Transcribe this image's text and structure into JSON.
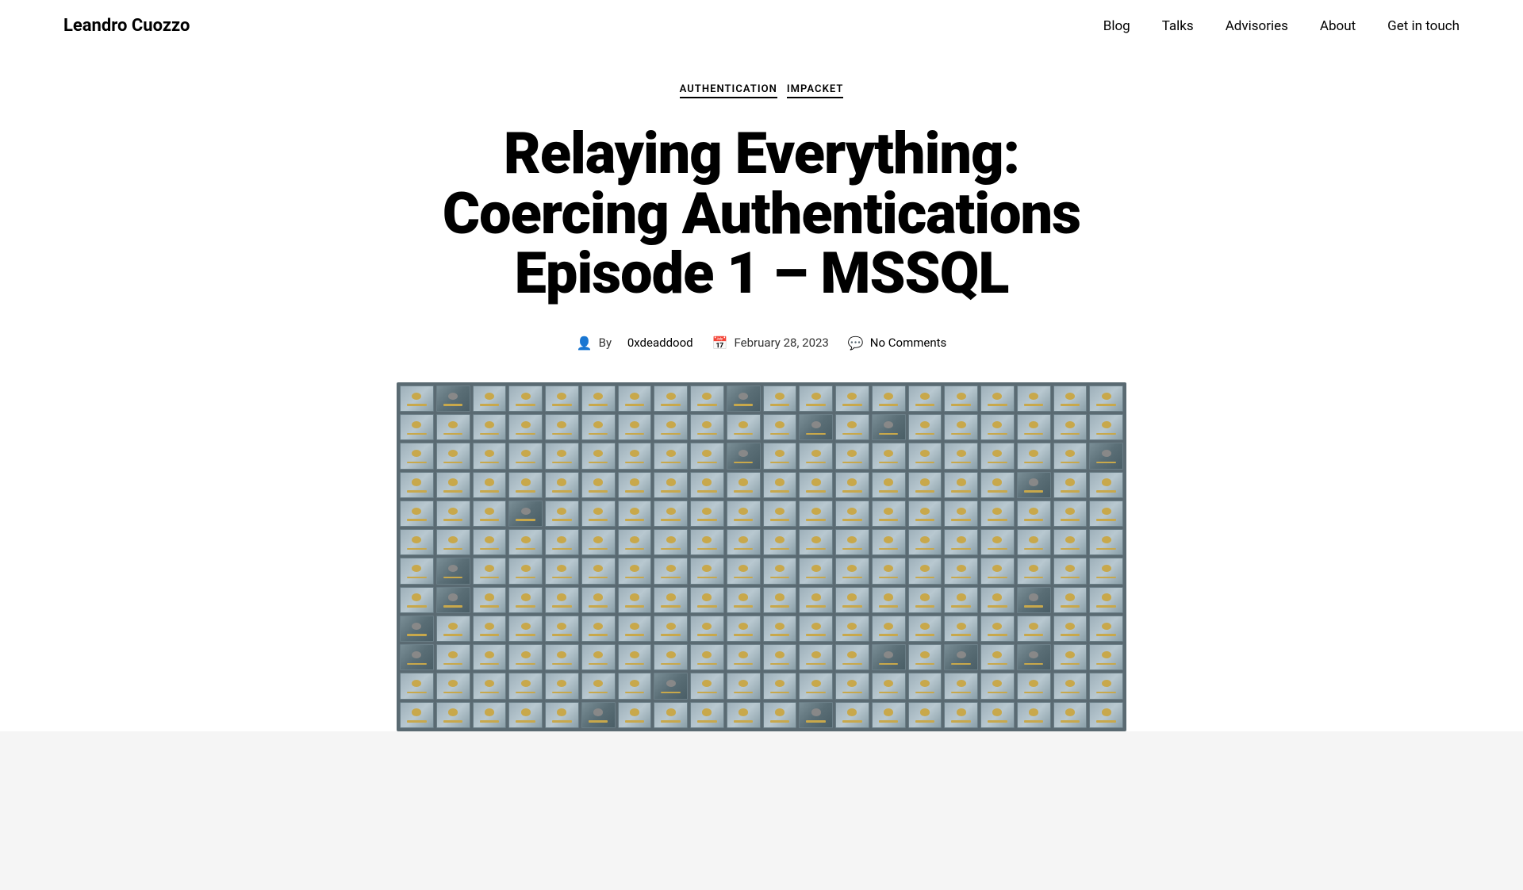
{
  "site": {
    "title": "Leandro Cuozzo"
  },
  "nav": {
    "items": [
      {
        "label": "Blog",
        "href": "#"
      },
      {
        "label": "Talks",
        "href": "#"
      },
      {
        "label": "Advisories",
        "href": "#"
      },
      {
        "label": "About",
        "href": "#"
      },
      {
        "label": "Get in touch",
        "href": "#"
      }
    ]
  },
  "post": {
    "categories": [
      {
        "label": "AUTHENTICATION",
        "href": "#"
      },
      {
        "label": "IMPACKET",
        "href": "#"
      }
    ],
    "title": "Relaying Everything: Coercing Authentications Episode 1 – MSSQL",
    "meta": {
      "author_prefix": "By",
      "author": "0xdeaddood",
      "date": "February 28, 2023",
      "comments": "No Comments"
    }
  }
}
